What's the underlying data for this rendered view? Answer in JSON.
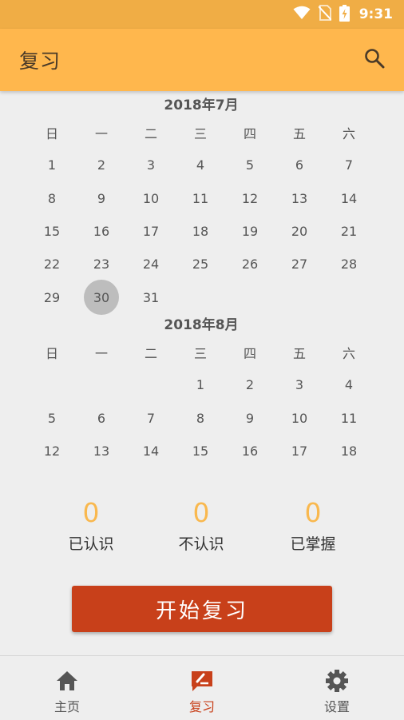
{
  "status_bar": {
    "time": "9:31",
    "icons": [
      "wifi-icon",
      "no-sim-icon",
      "battery-charging-icon"
    ]
  },
  "app_bar": {
    "title": "复习",
    "search_icon": "search-icon"
  },
  "calendar": {
    "weekdays": [
      "日",
      "一",
      "二",
      "三",
      "四",
      "五",
      "六"
    ],
    "months": [
      {
        "title": "2018年7月",
        "first_weekday": 0,
        "days": 31,
        "selected_day": 30
      },
      {
        "title": "2018年8月",
        "first_weekday": 3,
        "days_shown": 18
      }
    ]
  },
  "stats": [
    {
      "value": "0",
      "label": "已认识"
    },
    {
      "value": "0",
      "label": "不认识"
    },
    {
      "value": "0",
      "label": "已掌握"
    }
  ],
  "start_button": {
    "label": "开始复习"
  },
  "bottom_nav": [
    {
      "label": "主页",
      "icon": "home-icon",
      "active": false
    },
    {
      "label": "复习",
      "icon": "review-icon",
      "active": true
    },
    {
      "label": "设置",
      "icon": "gear-icon",
      "active": false
    }
  ],
  "colors": {
    "app_bar": "#ffb74d",
    "status_bar": "#f0ad45",
    "accent": "#c8401a",
    "stat_value": "#f9b84e",
    "background": "#eeeeee"
  }
}
